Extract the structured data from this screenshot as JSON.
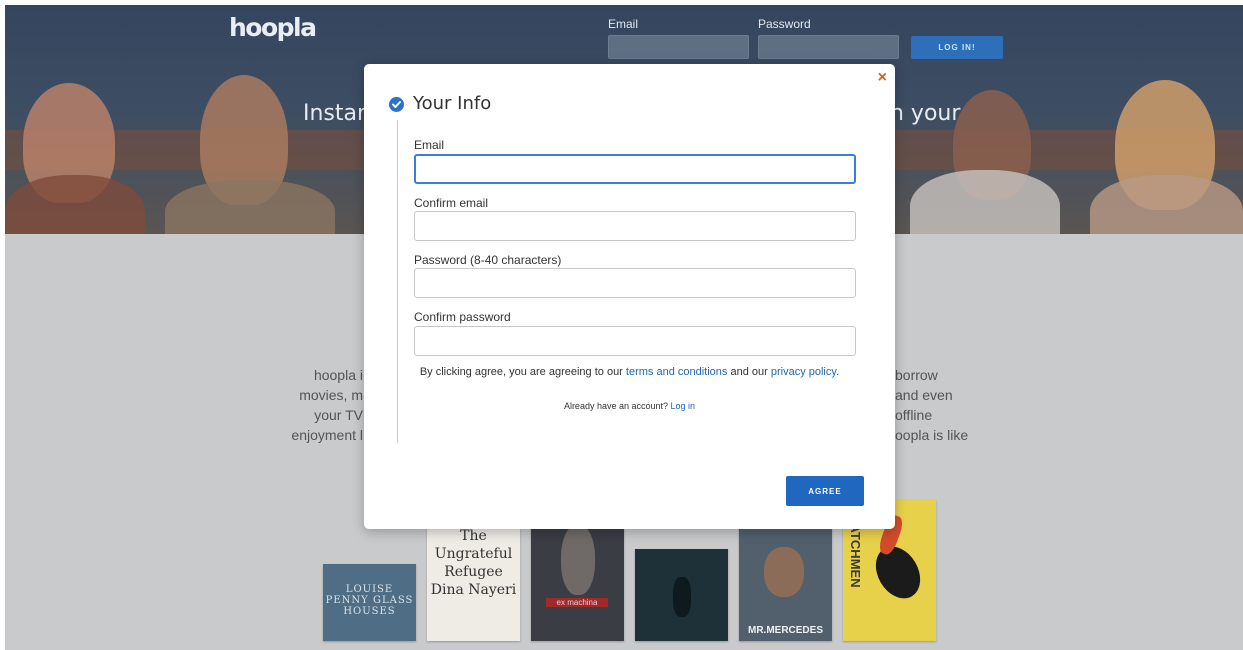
{
  "header": {
    "logo": "hoopla",
    "email_label": "Email",
    "password_label": "Password",
    "login_button": "LOG IN!"
  },
  "hero": {
    "text_left": "Instant",
    "text_right": "h your"
  },
  "background_copy": {
    "left_lines": [
      "hoopla i",
      "movies, m",
      "your TV",
      "enjoyment l"
    ],
    "right_lines": [
      "borrow",
      "and even",
      "offline",
      "oopla is like"
    ]
  },
  "books": [
    {
      "title": "LOUISE PENNY GLASS HOUSES",
      "color": "#4f6e86"
    },
    {
      "title": "The Ungrateful Refugee Dina Nayeri",
      "color": "#efece6"
    },
    {
      "title": "ex machina",
      "color": "#3a3d44"
    },
    {
      "title": "",
      "color": "#1f3138"
    },
    {
      "title": "MR.MERCEDES",
      "color": "#52606e"
    },
    {
      "title": "WATCHMEN",
      "color": "#e8d14a"
    }
  ],
  "modal": {
    "title": "Your Info",
    "close_symbol": "×",
    "fields": [
      {
        "label": "Email",
        "value": ""
      },
      {
        "label": "Confirm email",
        "value": ""
      },
      {
        "label": "Password (8-40 characters)",
        "value": ""
      },
      {
        "label": "Confirm password",
        "value": ""
      }
    ],
    "agree_text_1": "By clicking agree, you are agreeing to our",
    "terms_link": "terms and conditions",
    "agree_text_2": "and our",
    "privacy_link": "privacy policy",
    "agree_text_3": ".",
    "account_text": "Already have an account?",
    "login_link": "Log in",
    "agree_button": "AGREE"
  },
  "colors": {
    "accent": "#1f67bf",
    "close": "#e05a18",
    "focus_border": "#3a7fd0"
  }
}
